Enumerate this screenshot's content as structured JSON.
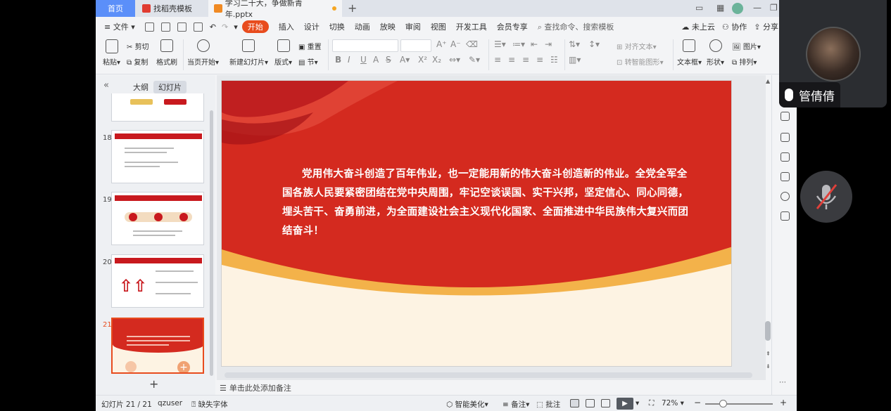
{
  "tabs": [
    {
      "label": "首页"
    },
    {
      "label": "找稻壳模板"
    },
    {
      "label": "学习二十大，争做新青年.pptx"
    }
  ],
  "menu": {
    "file": "文件",
    "items": [
      "开始",
      "插入",
      "设计",
      "切换",
      "动画",
      "放映",
      "审阅",
      "视图",
      "开发工具",
      "会员专享"
    ],
    "search_placeholder": "查找命令、搜索模板",
    "cloud": "未上云",
    "collab": "协作",
    "share": "分享"
  },
  "ribbon": {
    "paste": "粘贴",
    "cut": "剪切",
    "copy": "复制",
    "format_painter": "格式刷",
    "play_current": "当页开始",
    "new_slide": "新建幻灯片",
    "layout": "版式",
    "section": "节",
    "reset": "重置",
    "align_text": "对齐文本",
    "smart_shape": "转智能图形",
    "textbox": "文本框",
    "shape": "形状",
    "picture": "图片",
    "arrange": "排列"
  },
  "left_panel": {
    "tab_outline": "大纲",
    "tab_slides": "幻灯片",
    "slide_numbers": [
      "18",
      "19",
      "20",
      "21"
    ]
  },
  "slide": {
    "body": "党用伟大奋斗创造了百年伟业，也一定能用新的伟大奋斗创造新的伟业。全党全军全国各族人民要紧密团结在党中央周围，牢记空谈误国、实干兴邦，坚定信心、同心同德，埋头苦干、奋勇前进，为全面建设社会主义现代化国家、全面推进中华民族伟大复兴而团结奋斗！"
  },
  "notes_hint": "单击此处添加备注",
  "status": {
    "slide_counter": "幻灯片 21 / 21",
    "author": "qzuser",
    "missing_font": "缺失字体",
    "beautify": "智能美化",
    "notes": "备注",
    "comments": "批注",
    "zoom": "72%"
  },
  "meeting": {
    "participant": "管倩倩"
  },
  "colors": {
    "accent": "#e84c1e",
    "slide_red": "#d42a1f",
    "slide_cream": "#fdf3e3"
  }
}
